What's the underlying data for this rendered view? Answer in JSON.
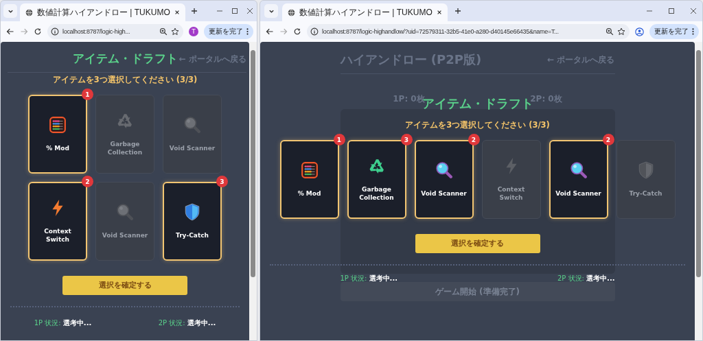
{
  "windows": [
    {
      "tab": {
        "title": "数値計算ハイアンドロー | TUKUMO"
      },
      "url": "localhost:8787/logic-high...",
      "profile": {
        "kind": "letter",
        "letter": "T"
      },
      "update_button": "更新を完了",
      "page": {
        "back_link": "← ポータルへ戻る"
      },
      "draft": {
        "title": "アイテム・ドラフト",
        "instruction": "アイテムを3つ選択してください (3/3)",
        "items": [
          {
            "name": "% Mod",
            "kind": "abacus",
            "selected": true,
            "badge": "1"
          },
          {
            "name": "Garbage Collection",
            "kind": "recycle",
            "selected": false
          },
          {
            "name": "Void Scanner",
            "kind": "magnifier",
            "selected": false
          },
          {
            "name": "Context Switch",
            "kind": "bolt",
            "selected": true,
            "badge": "2"
          },
          {
            "name": "Void Scanner",
            "kind": "magnifier",
            "selected": false
          },
          {
            "name": "Try-Catch",
            "kind": "shield",
            "selected": true,
            "badge": "3"
          }
        ],
        "confirm_button": "選択を確定する",
        "status": [
          {
            "label": "1P 状況:",
            "value": "選考中..."
          },
          {
            "label": "2P 状況:",
            "value": "選考中..."
          }
        ]
      }
    },
    {
      "tab": {
        "title": "数値計算ハイアンドロー | TUKUMO"
      },
      "url": "localhost:8787/logic-highandlow/?uid=72579311-32b5-41e0-a280-d40145e66435&name=T...",
      "profile": {
        "kind": "person"
      },
      "update_button": "更新を完了",
      "page": {
        "heading": "ハイアンドロー (P2P版)",
        "back_link": "← ポータルへ戻る",
        "counts": [
          "1P: 0枚",
          "2P: 0枚"
        ],
        "start_button": "ゲーム開始 (準備完了)"
      },
      "draft": {
        "title": "アイテム・ドラフト",
        "instruction": "アイテムを3つ選択してください (3/3)",
        "items": [
          {
            "name": "% Mod",
            "kind": "abacus",
            "selected": true,
            "badge": "1"
          },
          {
            "name": "Garbage Collection",
            "kind": "recycle",
            "selected": true,
            "badge": "3"
          },
          {
            "name": "Void Scanner",
            "kind": "magnifier",
            "selected": true,
            "badge": "2"
          },
          {
            "name": "Context Switch",
            "kind": "bolt",
            "selected": false
          },
          {
            "name": "Void Scanner",
            "kind": "magnifier",
            "selected": true,
            "badge": "2"
          },
          {
            "name": "Try-Catch",
            "kind": "shield",
            "selected": false
          }
        ],
        "confirm_button": "選択を確定する",
        "status": [
          {
            "label": "1P 状況:",
            "value": "選考中..."
          },
          {
            "label": "2P 状況:",
            "value": "選考中..."
          }
        ]
      }
    }
  ]
}
